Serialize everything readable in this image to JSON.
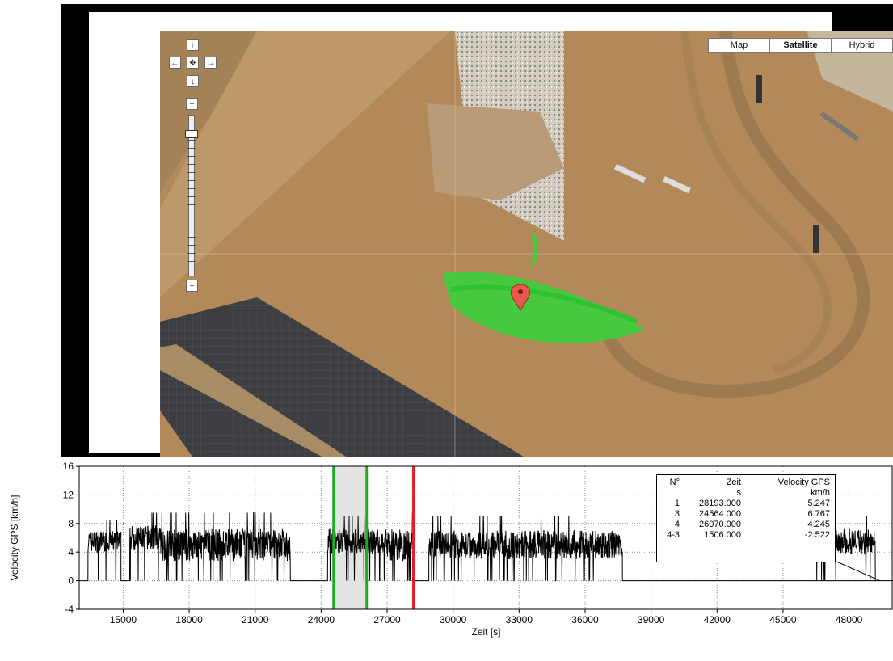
{
  "map": {
    "map_types": [
      {
        "label": "Map",
        "active": false
      },
      {
        "label": "Satellite",
        "active": true
      },
      {
        "label": "Hybrid",
        "active": false
      }
    ],
    "nav": {
      "up": "↑",
      "down": "↓",
      "left": "←",
      "right": "→",
      "center": "✥"
    },
    "zoom": {
      "in": "+",
      "out": "−"
    }
  },
  "chart_data": {
    "type": "line",
    "title": "",
    "xlabel": "Zeit [s]",
    "ylabel": "Velocity GPS [km/h]",
    "xlim": [
      13000,
      50000
    ],
    "ylim": [
      -4,
      16
    ],
    "x_ticks": [
      15000,
      18000,
      21000,
      24000,
      27000,
      30000,
      33000,
      36000,
      39000,
      42000,
      45000,
      48000
    ],
    "y_ticks": [
      -4,
      0,
      4,
      8,
      12,
      16
    ],
    "grid": true,
    "series": [
      {
        "color": "#000000",
        "segments": [
          {
            "x_start": 13000,
            "x_end": 13400,
            "level": 0,
            "noise": 0
          },
          {
            "x_start": 13400,
            "x_end": 14900,
            "level": 5.5,
            "noise": 3
          },
          {
            "x_start": 14900,
            "x_end": 15300,
            "level": 0,
            "noise": 0
          },
          {
            "x_start": 15300,
            "x_end": 16700,
            "level": 6,
            "noise": 3.5
          },
          {
            "x_start": 16700,
            "x_end": 22600,
            "level": 5,
            "noise": 4.5
          },
          {
            "x_start": 22600,
            "x_end": 24300,
            "level": 0,
            "noise": 0
          },
          {
            "x_start": 24300,
            "x_end": 27000,
            "level": 5.5,
            "noise": 3.5
          },
          {
            "x_start": 27000,
            "x_end": 28200,
            "level": 5,
            "noise": 4.5
          },
          {
            "x_start": 28200,
            "x_end": 28900,
            "level": 0,
            "noise": 0
          },
          {
            "x_start": 28900,
            "x_end": 37700,
            "level": 5,
            "noise": 4
          },
          {
            "x_start": 37700,
            "x_end": 49400,
            "level": 0,
            "noise": 0
          },
          {
            "x_start": 46200,
            "x_end": 49200,
            "level": 5.5,
            "noise": 3.5
          },
          {
            "x_start": 49400,
            "x_end": 50000,
            "level": 0,
            "noise": 0
          }
        ]
      }
    ],
    "cursors": [
      {
        "id": "1",
        "x": 28193,
        "color": "#e0202a"
      },
      {
        "id": "3",
        "x": 24564,
        "color": "#22aa22"
      },
      {
        "id": "4",
        "x": 26070,
        "color": "#22aa22"
      }
    ],
    "highlight": {
      "x_start": 24564,
      "x_end": 26070,
      "color": "#e4e4e4"
    }
  },
  "cursor_table": {
    "headers": [
      "N°",
      "Zeit",
      "Velocity GPS"
    ],
    "units": [
      "",
      "s",
      "km/h"
    ],
    "rows": [
      {
        "n": "1",
        "zeit": "28193.000",
        "value": "5.247"
      },
      {
        "n": "3",
        "zeit": "24564.000",
        "value": "6.767"
      },
      {
        "n": "4",
        "zeit": "26070.000",
        "value": "4.245"
      },
      {
        "n": "4-3",
        "zeit": "1506.000",
        "value": "-2.522"
      }
    ]
  }
}
